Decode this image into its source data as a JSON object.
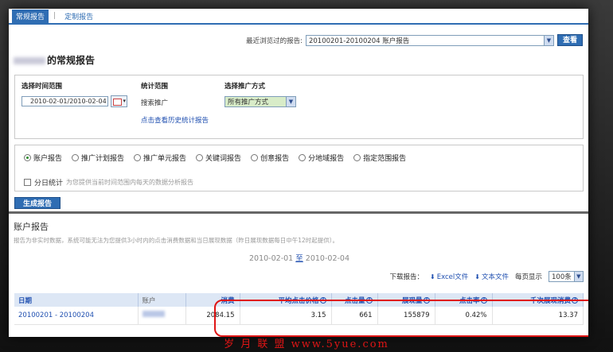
{
  "tabs": {
    "standard": "常规报告",
    "custom": "定制报告"
  },
  "recent": {
    "label": "最近浏览过的报告:",
    "value": "20100201-20100204 账户报告",
    "button": "查看"
  },
  "title": "的常规报告",
  "time_range": {
    "label": "选择时间范围",
    "value": "2010-02-01/2010-02-04"
  },
  "stat_range": {
    "label": "统计范围",
    "value": "搜索推广",
    "history_link": "点击查看历史统计报告"
  },
  "promo_mode": {
    "label": "选择推广方式",
    "value": "所有推广方式"
  },
  "report_types": [
    "账户报告",
    "推广计划报告",
    "推广单元报告",
    "关键词报告",
    "创意报告",
    "分地域报告",
    "指定范围报告"
  ],
  "daily": {
    "label": "分日统计",
    "hint": "为您提供当前时间范围内每天的数据分析报告"
  },
  "generate_button": "生成报告",
  "section_title": "账户报告",
  "note": "报告为非实时数据，系统可能无法为您提供3小时内的点击消费数据和当日展现数据（昨日展现数据每日中午12时起提供）。",
  "range": {
    "start": "2010-02-01",
    "sep": "至",
    "end": "2010-02-04"
  },
  "download": {
    "label": "下载报告：",
    "excel": "Excel文件",
    "text": "文本文件",
    "per_page_label": "每页显示",
    "per_page": "100条"
  },
  "table": {
    "headers": [
      "日期",
      "账户",
      "消费",
      "平均点击价格",
      "点击量",
      "展现量",
      "点击率",
      "千次展现消费"
    ],
    "row": [
      "20100201 - 20100204",
      "",
      "2084.15",
      "3.15",
      "661",
      "155879",
      "0.42%",
      "13.37"
    ]
  },
  "watermark": "岁 月 联 盟   www.5yue.com",
  "colors": {
    "accent": "#2f6db3",
    "highlight": "#e01515"
  }
}
